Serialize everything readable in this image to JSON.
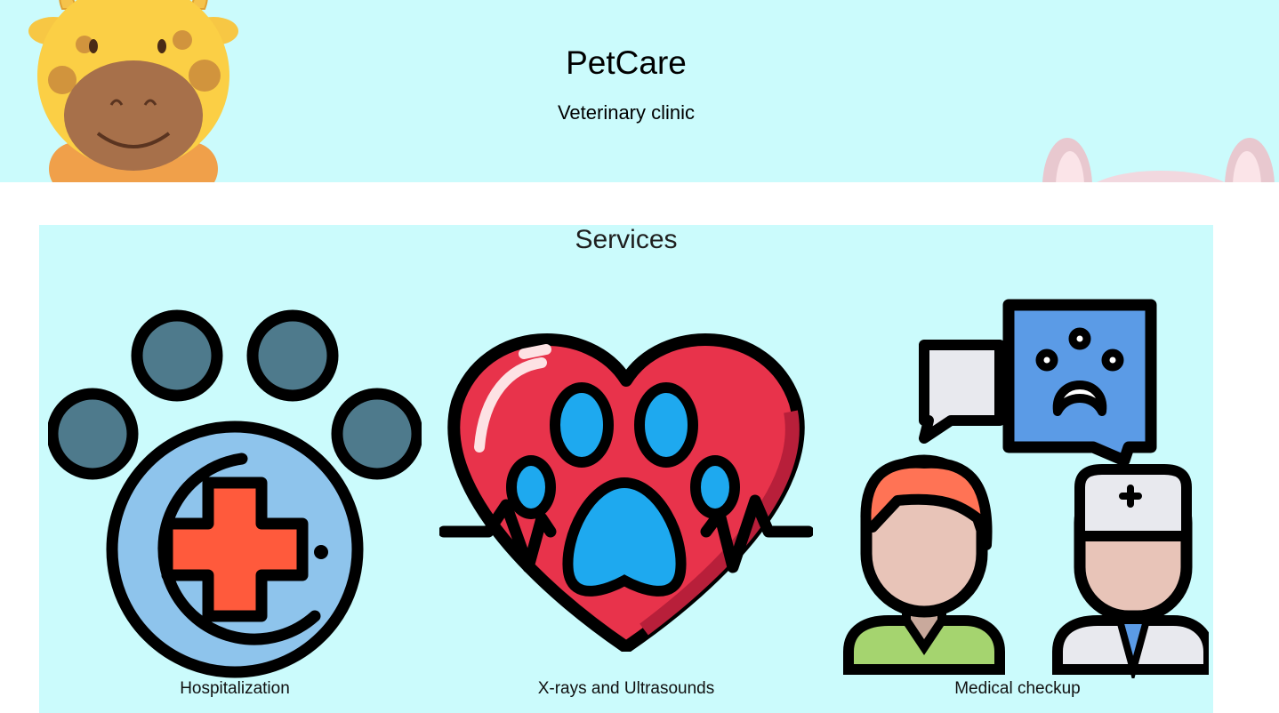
{
  "header": {
    "title": "PetCare",
    "subtitle": "Veterinary clinic",
    "colors": {
      "background": "#cbfbfc"
    },
    "decorations": [
      "giraffe-illustration",
      "bunny-ears-illustration"
    ]
  },
  "services": {
    "heading": "Services",
    "items": [
      {
        "label": "Hospitalization",
        "icon": "paw-medical-cross-icon"
      },
      {
        "label": "X-rays and Ultrasounds",
        "icon": "heart-paw-heartbeat-icon"
      },
      {
        "label": "Medical checkup",
        "icon": "owner-and-vet-chat-icon"
      }
    ]
  }
}
